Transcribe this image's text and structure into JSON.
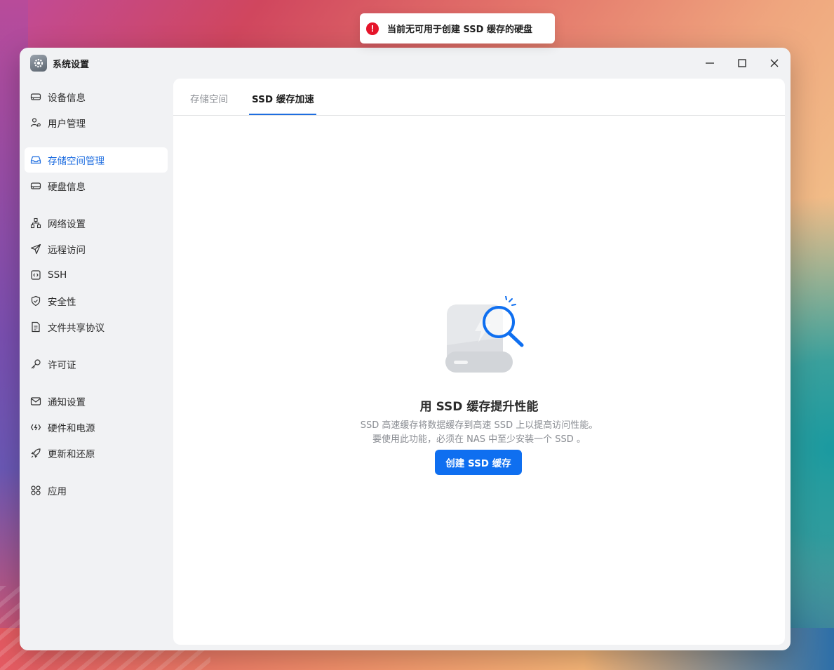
{
  "toast": {
    "message": "当前无可用于创建 SSD 缓存的硬盘",
    "icon": "error-icon",
    "color": "#e5142a"
  },
  "window": {
    "title": "系统设置"
  },
  "sidebar": {
    "items": [
      {
        "label": "设备信息",
        "icon": "device-icon",
        "active": false
      },
      {
        "label": "用户管理",
        "icon": "users-icon",
        "active": false
      },
      {
        "label": "存储空间管理",
        "icon": "storage-icon",
        "active": true
      },
      {
        "label": "硬盘信息",
        "icon": "disk-icon",
        "active": false
      },
      {
        "label": "网络设置",
        "icon": "network-icon",
        "active": false
      },
      {
        "label": "远程访问",
        "icon": "send-icon",
        "active": false
      },
      {
        "label": "SSH",
        "icon": "terminal-icon",
        "active": false
      },
      {
        "label": "安全性",
        "icon": "shield-icon",
        "active": false
      },
      {
        "label": "文件共享协议",
        "icon": "document-icon",
        "active": false
      },
      {
        "label": "许可证",
        "icon": "key-icon",
        "active": false
      },
      {
        "label": "通知设置",
        "icon": "mail-icon",
        "active": false
      },
      {
        "label": "硬件和电源",
        "icon": "power-icon",
        "active": false
      },
      {
        "label": "更新和还原",
        "icon": "rocket-icon",
        "active": false
      },
      {
        "label": "应用",
        "icon": "apps-icon",
        "active": false
      }
    ]
  },
  "tabs": [
    {
      "label": "存储空间",
      "active": false
    },
    {
      "label": "SSD 缓存加速",
      "active": true
    }
  ],
  "empty_state": {
    "title": "用 SSD 缓存提升性能",
    "desc_line1": "SSD 高速缓存将数据缓存到高速 SSD 上以提高访问性能。",
    "desc_line2": "要使用此功能，必须在 NAS 中至少安装一个 SSD 。",
    "button_label": "创建 SSD 缓存"
  },
  "colors": {
    "accent": "#0f6ff0",
    "active_text": "#1f6ee0"
  }
}
